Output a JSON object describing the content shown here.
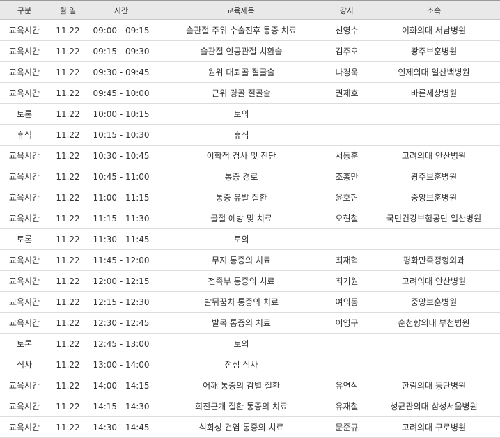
{
  "headers": [
    "구분",
    "월.일",
    "시간",
    "교육제목",
    "강사",
    "소속"
  ],
  "rows": [
    [
      "교육시간",
      "11.22",
      "09:00 - 09:15",
      "슬관절 주위 수술전후 통증 치료",
      "신영수",
      "이화의대 서남병원"
    ],
    [
      "교육시간",
      "11.22",
      "09:15 - 09:30",
      "슬관절 인공관절 치환술",
      "김주오",
      "광주보훈병원"
    ],
    [
      "교육시간",
      "11.22",
      "09:30 - 09:45",
      "원위 대퇴골 절골술",
      "나경욱",
      "인제의대 일산백병원"
    ],
    [
      "교육시간",
      "11.22",
      "09:45 - 10:00",
      "근위 경골 절골술",
      "권제호",
      "바른세상병원"
    ],
    [
      "토론",
      "11.22",
      "10:00 - 10:15",
      "토의",
      "",
      ""
    ],
    [
      "휴식",
      "11.22",
      "10:15 - 10:30",
      "휴식",
      "",
      ""
    ],
    [
      "교육시간",
      "11.22",
      "10:30 - 10:45",
      "이학적 검사 및 진단",
      "서동훈",
      "고려의대 안산병원"
    ],
    [
      "교육시간",
      "11.22",
      "10:45 - 11:00",
      "통증 경로",
      "조홍만",
      "광주보훈병원"
    ],
    [
      "교육시간",
      "11.22",
      "11:00 - 11:15",
      "통증 유발 질환",
      "윤호현",
      "중앙보훈병원"
    ],
    [
      "교육시간",
      "11.22",
      "11:15 - 11:30",
      "골절 예방 및 치료",
      "오현철",
      "국민건강보험공단 일산병원"
    ],
    [
      "토론",
      "11.22",
      "11:30 - 11:45",
      "토의",
      "",
      ""
    ],
    [
      "교육시간",
      "11.22",
      "11:45 - 12:00",
      "무지 통증의 치료",
      "최재혁",
      "평화만족정형외과"
    ],
    [
      "교육시간",
      "11.22",
      "12:00 - 12:15",
      "전족부 통증의 치료",
      "최기원",
      "고려의대 안산병원"
    ],
    [
      "교육시간",
      "11.22",
      "12:15 - 12:30",
      "발뒤꿈치 통증의 치료",
      "여의동",
      "중앙보훈병원"
    ],
    [
      "교육시간",
      "11.22",
      "12:30 - 12:45",
      "발목 통증의 치료",
      "이영구",
      "순천향의대 부천병원"
    ],
    [
      "토론",
      "11.22",
      "12:45 - 13:00",
      "토의",
      "",
      ""
    ],
    [
      "식사",
      "11.22",
      "13:00 - 14:00",
      "점심 식사",
      "",
      ""
    ],
    [
      "교육시간",
      "11.22",
      "14:00 - 14:15",
      "어깨 통증의 감별 질환",
      "유연식",
      "한림의대 동탄병원"
    ],
    [
      "교육시간",
      "11.22",
      "14:15 - 14:30",
      "회전근개 질환 통증의 치료",
      "유재철",
      "성균관의대 삼성서울병원"
    ],
    [
      "교육시간",
      "11.22",
      "14:30 - 14:45",
      "석회성 건염 통증의 치료",
      "문준규",
      "고려의대 구로병원"
    ]
  ]
}
